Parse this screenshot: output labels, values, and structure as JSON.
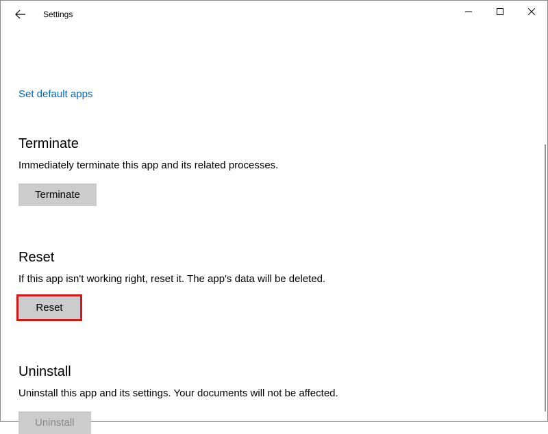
{
  "window": {
    "title": "Settings"
  },
  "link": {
    "default_apps": "Set default apps"
  },
  "terminate": {
    "heading": "Terminate",
    "description": "Immediately terminate this app and its related processes.",
    "button": "Terminate"
  },
  "reset": {
    "heading": "Reset",
    "description": "If this app isn't working right, reset it. The app's data will be deleted.",
    "button": "Reset"
  },
  "uninstall": {
    "heading": "Uninstall",
    "description": "Uninstall this app and its settings. Your documents will not be affected.",
    "button": "Uninstall"
  }
}
